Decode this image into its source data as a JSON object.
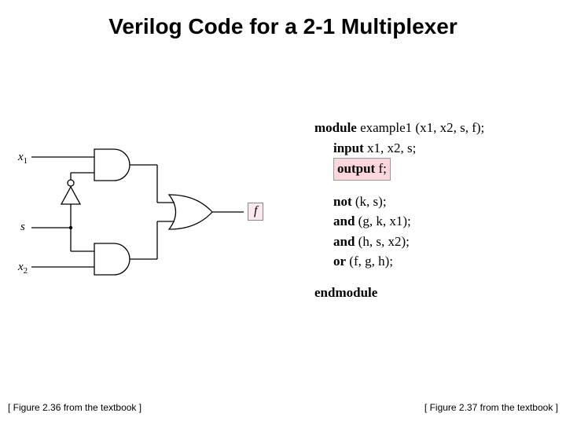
{
  "title": "Verilog Code for a 2-1 Multiplexer",
  "circuit": {
    "inputs": {
      "x1": "x",
      "x1_sub": "1",
      "x2": "x",
      "x2_sub": "2",
      "s": "s"
    },
    "output": "f"
  },
  "code": {
    "kw_module": "module",
    "module_decl": " example1 (x1, x2, s, f);",
    "kw_input": "input",
    "input_decl": " x1, x2, s;",
    "kw_output": "output",
    "output_decl": " f;",
    "kw_not": "not",
    "not_decl": " (k, s);",
    "kw_and1": "and",
    "and1_decl": " (g, k, x1);",
    "kw_and2": "and",
    "and2_decl": " (h, s, x2);",
    "kw_or": "or",
    "or_decl": " (f, g, h);",
    "kw_endmodule": "endmodule"
  },
  "captions": {
    "left": "[ Figure 2.36 from the textbook ]",
    "right": "[ Figure 2.37 from the textbook ]"
  }
}
